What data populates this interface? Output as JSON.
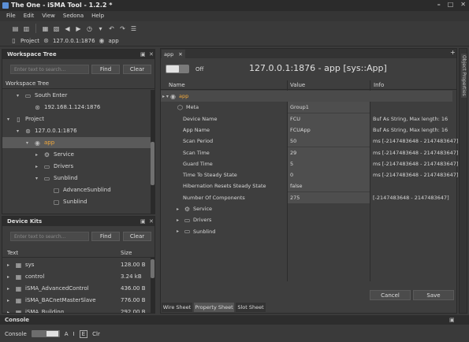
{
  "app": {
    "title": "The One - iSMA Tool - 1.2.2 *"
  },
  "menu": [
    "File",
    "Edit",
    "View",
    "Sedona",
    "Help"
  ],
  "breadcrumb": {
    "project": "Project",
    "host": "127.0.0.1:1876",
    "app": "app"
  },
  "workspace": {
    "title": "Workspace Tree",
    "search_placeholder": "Enter text to search...",
    "find": "Find",
    "clear": "Clear",
    "section": "Workspace Tree",
    "items": [
      {
        "label": "South Enter",
        "depth": 1,
        "icon": "folder-icon",
        "arrow": "▾"
      },
      {
        "label": "192.168.1.124:1876",
        "depth": 2,
        "icon": "device-icon",
        "arrow": ""
      },
      {
        "label": "Project",
        "depth": 0,
        "icon": "project-icon",
        "arrow": "▾"
      },
      {
        "label": "127.0.0.1:1876",
        "depth": 1,
        "icon": "device-icon",
        "arrow": "▾"
      },
      {
        "label": "app",
        "depth": 2,
        "icon": "app-icon",
        "arrow": "▾",
        "selected": true
      },
      {
        "label": "Service",
        "depth": 3,
        "icon": "gear-icon",
        "arrow": "▸"
      },
      {
        "label": "Drivers",
        "depth": 3,
        "icon": "folder-icon",
        "arrow": "▸"
      },
      {
        "label": "Sunblind",
        "depth": 3,
        "icon": "folder-icon",
        "arrow": "▾"
      },
      {
        "label": "AdvanceSunblind",
        "depth": 4,
        "icon": "component-icon",
        "arrow": ""
      },
      {
        "label": "Sunblind",
        "depth": 4,
        "icon": "component-icon",
        "arrow": ""
      }
    ]
  },
  "kits": {
    "title": "Device Kits",
    "search_placeholder": "Enter text to search...",
    "find": "Find",
    "clear": "Clear",
    "col_text": "Text",
    "col_size": "Size",
    "rows": [
      {
        "name": "sys",
        "size": "128.00 B"
      },
      {
        "name": "control",
        "size": "3.24 kB"
      },
      {
        "name": "iSMA_AdvancedControl",
        "size": "436.00 B"
      },
      {
        "name": "iSMA_BACnetMasterSlave",
        "size": "776.00 B"
      },
      {
        "name": "iSMA_Building",
        "size": "292.00 B"
      }
    ]
  },
  "editor": {
    "tab": "app",
    "toggle_label": "Off",
    "heading": "127.0.0.1:1876 - app [sys::App]",
    "col_name": "Name",
    "col_value": "Value",
    "col_info": "Info",
    "rows": [
      {
        "name": "app",
        "value": "",
        "info": "",
        "depth": 0,
        "icon": "app-icon",
        "arrow": "▸ ▾",
        "highlight": true
      },
      {
        "name": "Meta",
        "value": "Group1",
        "info": "",
        "depth": 1,
        "icon": "meta-icon",
        "arrow": ""
      },
      {
        "name": "Device Name",
        "value": "FCU",
        "info": "Buf As String, Max length: 16",
        "depth": 1,
        "icon": "",
        "arrow": ""
      },
      {
        "name": "App Name",
        "value": "FCUApp",
        "info": "Buf As String, Max length: 16",
        "depth": 1,
        "icon": "",
        "arrow": ""
      },
      {
        "name": "Scan Period",
        "value": "50",
        "info": "ms  [-2147483648 - 2147483647]",
        "depth": 1,
        "icon": "",
        "arrow": ""
      },
      {
        "name": "Scan Time",
        "value": "29",
        "info": "ms  [-2147483648 - 2147483647]",
        "depth": 1,
        "icon": "",
        "arrow": ""
      },
      {
        "name": "Guard Time",
        "value": "5",
        "info": "ms  [-2147483648 - 2147483647]",
        "depth": 1,
        "icon": "",
        "arrow": ""
      },
      {
        "name": "Time To Steady State",
        "value": "0",
        "info": "ms  [-2147483648 - 2147483647]",
        "depth": 1,
        "icon": "",
        "arrow": ""
      },
      {
        "name": "Hibernation Resets Steady State",
        "value": "false",
        "info": "",
        "depth": 1,
        "icon": "",
        "arrow": ""
      },
      {
        "name": "Number Of Components",
        "value": "275",
        "info": "[-2147483648 - 2147483647]",
        "depth": 1,
        "icon": "",
        "arrow": ""
      },
      {
        "name": "Service",
        "value": "",
        "info": "",
        "depth": 1,
        "icon": "gear-icon",
        "arrow": "▸"
      },
      {
        "name": "Drivers",
        "value": "",
        "info": "",
        "depth": 1,
        "icon": "folder-icon",
        "arrow": "▸"
      },
      {
        "name": "Sunblind",
        "value": "",
        "info": "",
        "depth": 1,
        "icon": "folder-icon",
        "arrow": "▸"
      }
    ],
    "cancel": "Cancel",
    "save": "Save",
    "bottom_tabs": [
      "Wire Sheet",
      "Property Sheet",
      "Slot Sheet"
    ],
    "side_tab": "Object Properties"
  },
  "console": {
    "title": "Console",
    "label": "Console",
    "modes": [
      "A",
      "I",
      "E",
      "Clr"
    ]
  }
}
